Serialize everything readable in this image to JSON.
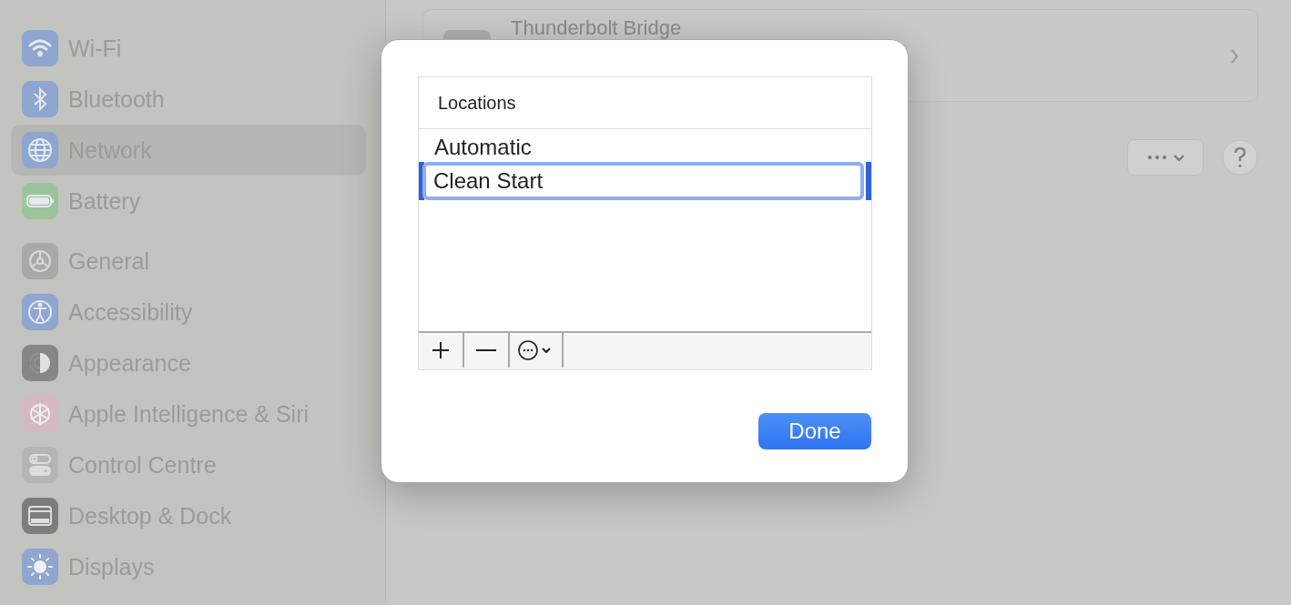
{
  "sidebar": {
    "groups": [
      [
        {
          "label": "Wi-Fi",
          "selected": false
        },
        {
          "label": "Bluetooth",
          "selected": false
        },
        {
          "label": "Network",
          "selected": true
        },
        {
          "label": "Battery",
          "selected": false
        }
      ],
      [
        {
          "label": "General",
          "selected": false
        },
        {
          "label": "Accessibility",
          "selected": false
        },
        {
          "label": "Appearance",
          "selected": false
        },
        {
          "label": "Apple Intelligence & Siri",
          "selected": false
        },
        {
          "label": "Control Centre",
          "selected": false
        },
        {
          "label": "Desktop & Dock",
          "selected": false
        },
        {
          "label": "Displays",
          "selected": false
        }
      ]
    ]
  },
  "main": {
    "service": {
      "name": "Thunderbolt Bridge"
    }
  },
  "dialog": {
    "table": {
      "header": "Locations",
      "rows": [
        {
          "name": "Automatic",
          "selected": false
        },
        {
          "name": "Clean Start",
          "selected": true
        }
      ]
    },
    "done_button": "Done"
  }
}
